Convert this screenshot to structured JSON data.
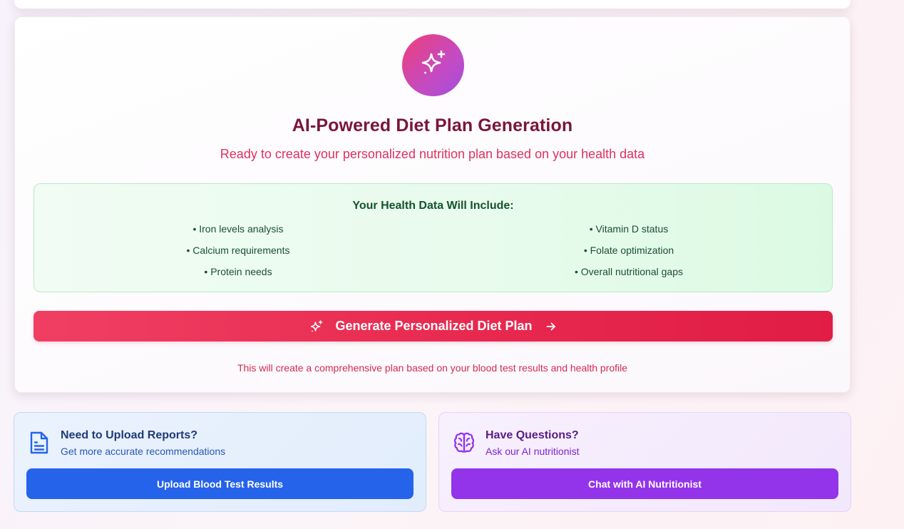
{
  "colors": {
    "title": "#7a1538",
    "accent_pink": "#e0305e",
    "generate_button": "#e8294f",
    "health_box_bg": "#e7fbec",
    "health_text": "#14532d",
    "upload_button": "#2563eb",
    "chat_button": "#9333ea"
  },
  "diet_plan": {
    "badge_icon": "sparkles-icon",
    "title": "AI-Powered Diet Plan Generation",
    "subtitle": "Ready to create your personalized nutrition plan based on your health data",
    "health_data": {
      "title": "Your Health Data Will Include:",
      "left_items": [
        "• Iron levels analysis",
        "• Calcium requirements",
        "• Protein needs"
      ],
      "right_items": [
        "• Vitamin D status",
        "• Folate optimization",
        "• Overall nutritional gaps"
      ]
    },
    "generate_button": {
      "label": "Generate Personalized Diet Plan",
      "leading_icon": "sparkles-icon",
      "trailing_icon": "arrow-right-icon"
    },
    "footnote": "This will create a comprehensive plan based on your blood test results and health profile"
  },
  "upload_card": {
    "icon": "document-icon",
    "title": "Need to Upload Reports?",
    "subtitle": "Get more accurate recommendations",
    "button_label": "Upload Blood Test Results"
  },
  "chat_card": {
    "icon": "brain-icon",
    "title": "Have Questions?",
    "subtitle": "Ask our AI nutritionist",
    "button_label": "Chat with AI Nutritionist"
  }
}
